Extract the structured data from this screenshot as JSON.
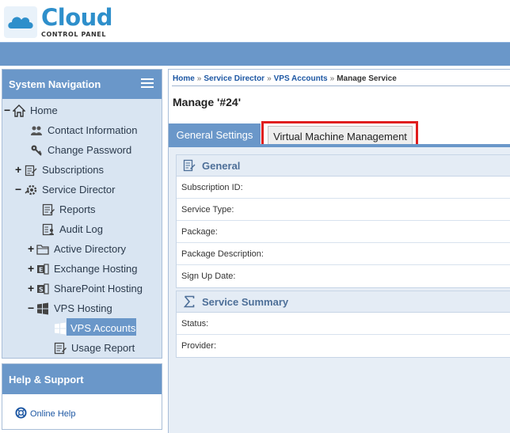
{
  "brand": {
    "title": "Cloud",
    "subtitle": "CONTROL PANEL"
  },
  "sidebar": {
    "title": "System Navigation",
    "items": [
      {
        "label": "Home",
        "icon": "home-icon",
        "toggle": "−"
      },
      {
        "label": "Contact Information",
        "icon": "users-icon"
      },
      {
        "label": "Change Password",
        "icon": "key-icon"
      },
      {
        "label": "Subscriptions",
        "icon": "edit-document-icon",
        "toggle": "+"
      },
      {
        "label": "Service Director",
        "icon": "cog-icon",
        "toggle": "−"
      },
      {
        "label": "Reports",
        "icon": "report-icon"
      },
      {
        "label": "Audit Log",
        "icon": "audit-log-icon"
      },
      {
        "label": "Active Directory",
        "icon": "folder-icon",
        "toggle": "+"
      },
      {
        "label": "Exchange Hosting",
        "icon": "exchange-icon",
        "toggle": "+"
      },
      {
        "label": "SharePoint Hosting",
        "icon": "sharepoint-icon",
        "toggle": "+"
      },
      {
        "label": "VPS Hosting",
        "icon": "windows-icon",
        "toggle": "−"
      },
      {
        "label": "VPS Accounts",
        "icon": "windows-icon",
        "selected": true
      },
      {
        "label": "Usage Report",
        "icon": "report-edit-icon"
      }
    ]
  },
  "help": {
    "title": "Help & Support",
    "link_label": "Online Help"
  },
  "breadcrumb": {
    "items": [
      "Home",
      "Service Director",
      "VPS Accounts"
    ],
    "current": "Manage Service",
    "separator": "»"
  },
  "page": {
    "title": "Manage '#24'"
  },
  "tabs": {
    "general": "General Settings",
    "vm": "Virtual Machine Management"
  },
  "sections": {
    "general": {
      "title": "General",
      "fields": [
        "Subscription ID:",
        "Service Type:",
        "Package:",
        "Package Description:",
        "Sign Up Date:"
      ]
    },
    "summary": {
      "title": "Service Summary",
      "fields": [
        "Status:",
        "Provider:"
      ]
    }
  },
  "colors": {
    "brand_blue": "#2e8fcb",
    "bar_blue": "#6a97c9",
    "highlight_red": "#e01e1e",
    "link_blue": "#1d57a3"
  }
}
